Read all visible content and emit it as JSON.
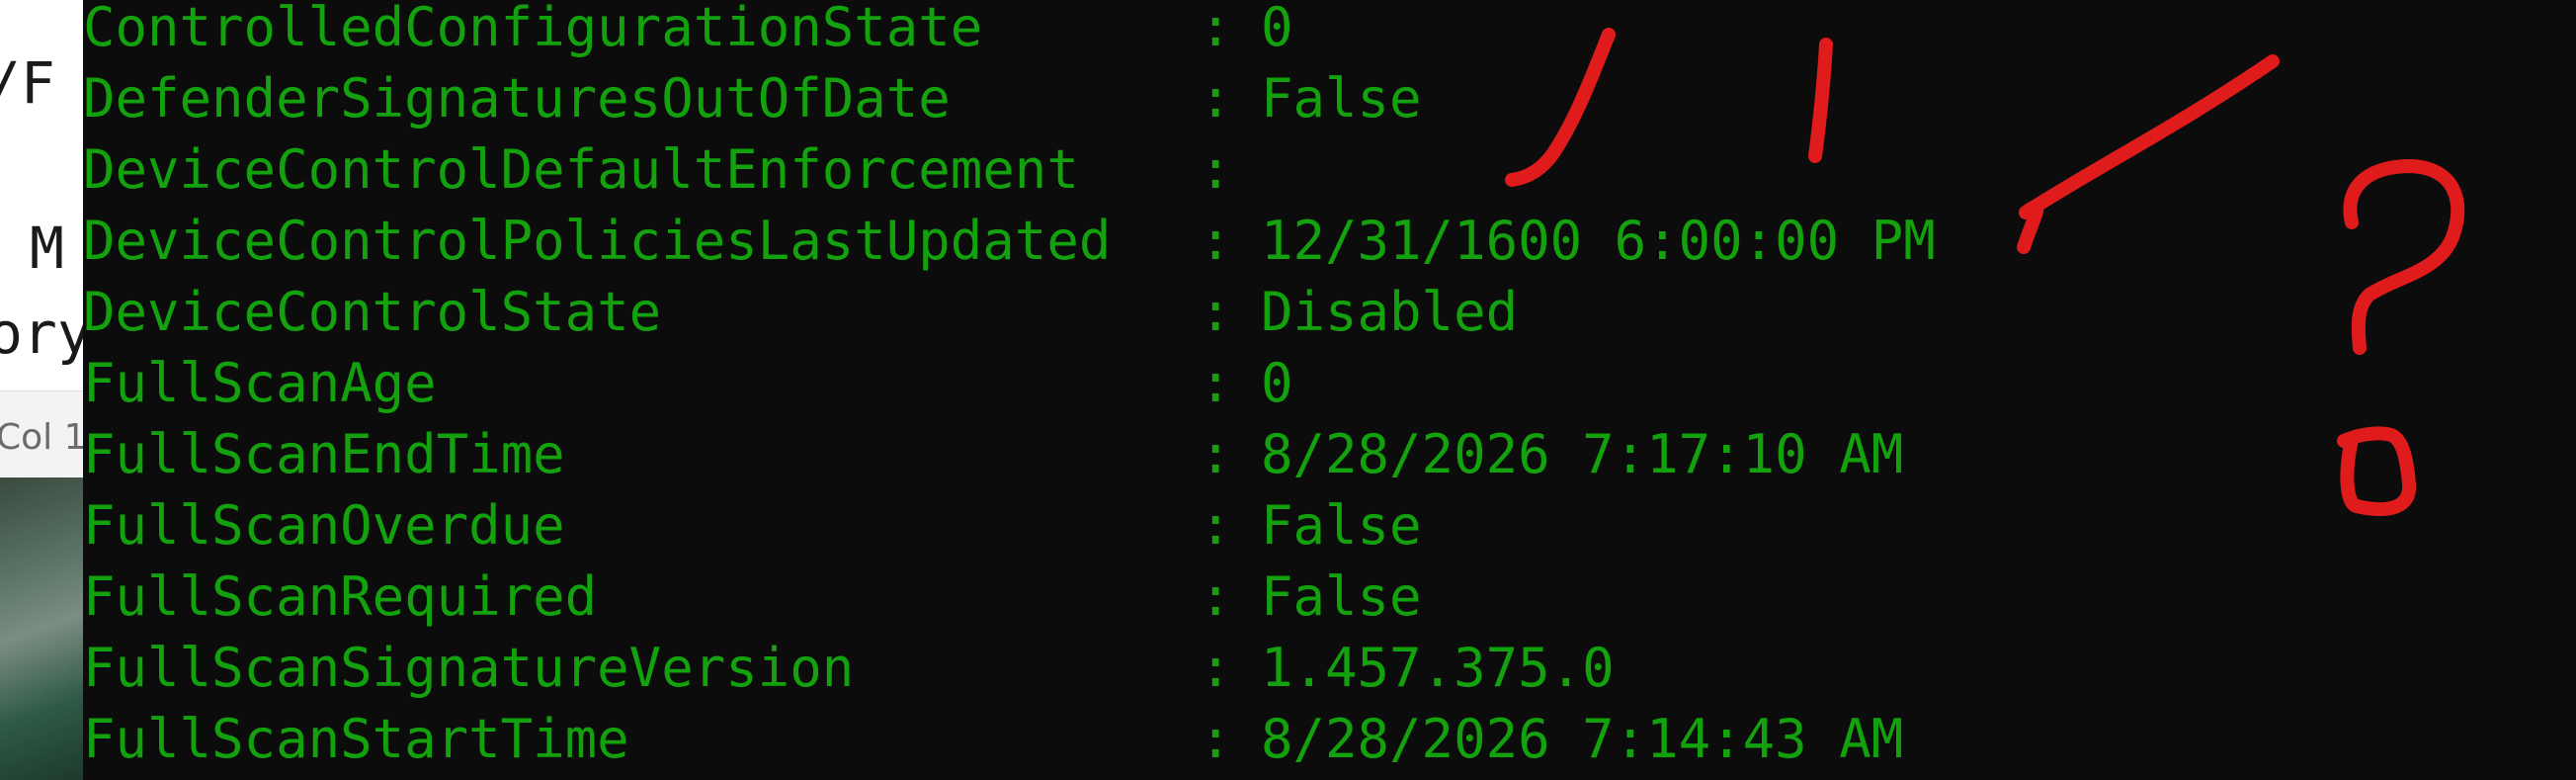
{
  "background_window": {
    "fragment_1": "/F",
    "fragment_2": "M",
    "fragment_3": "ory",
    "status_fragment": "Col 1"
  },
  "terminal": {
    "text_color": "#13a10e",
    "background": "#0c0c0c",
    "separator": ":",
    "rows": [
      {
        "key": "ControlledConfigurationState",
        "value": "0"
      },
      {
        "key": "DefenderSignaturesOutOfDate",
        "value": "False"
      },
      {
        "key": "DeviceControlDefaultEnforcement",
        "value": ""
      },
      {
        "key": "DeviceControlPoliciesLastUpdated",
        "value": "12/31/1600 6:00:00 PM"
      },
      {
        "key": "DeviceControlState",
        "value": "Disabled"
      },
      {
        "key": "FullScanAge",
        "value": "0"
      },
      {
        "key": "FullScanEndTime",
        "value": "8/28/2026 7:17:10 AM"
      },
      {
        "key": "FullScanOverdue",
        "value": "False"
      },
      {
        "key": "FullScanRequired",
        "value": "False"
      },
      {
        "key": "FullScanSignatureVersion",
        "value": "1.457.375.0"
      },
      {
        "key": "FullScanStartTime",
        "value": "8/28/2026 7:14:43 AM"
      }
    ]
  },
  "annotations": {
    "ink_color": "#e01b1b",
    "question_mark": "?"
  }
}
